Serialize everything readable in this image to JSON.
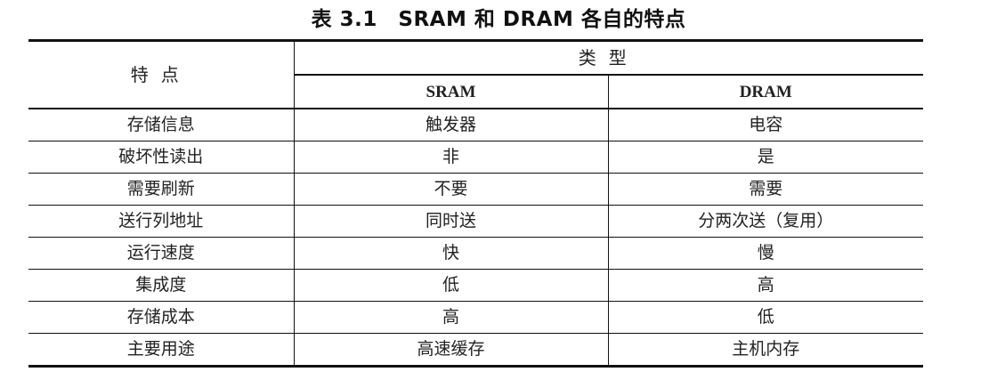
{
  "caption": "表 3.1　SRAM 和 DRAM 各自的特点",
  "header": {
    "feature": "特点",
    "type": "类型",
    "col_sram": "SRAM",
    "col_dram": "DRAM"
  },
  "rows": [
    {
      "feature": "存储信息",
      "sram": "触发器",
      "dram": "电容"
    },
    {
      "feature": "破坏性读出",
      "sram": "非",
      "dram": "是"
    },
    {
      "feature": "需要刷新",
      "sram": "不要",
      "dram": "需要"
    },
    {
      "feature": "送行列地址",
      "sram": "同时送",
      "dram": "分两次送（复用）"
    },
    {
      "feature": "运行速度",
      "sram": "快",
      "dram": "慢"
    },
    {
      "feature": "集成度",
      "sram": "低",
      "dram": "高"
    },
    {
      "feature": "存储成本",
      "sram": "高",
      "dram": "低"
    },
    {
      "feature": "主要用途",
      "sram": "高速缓存",
      "dram": "主机内存"
    }
  ]
}
